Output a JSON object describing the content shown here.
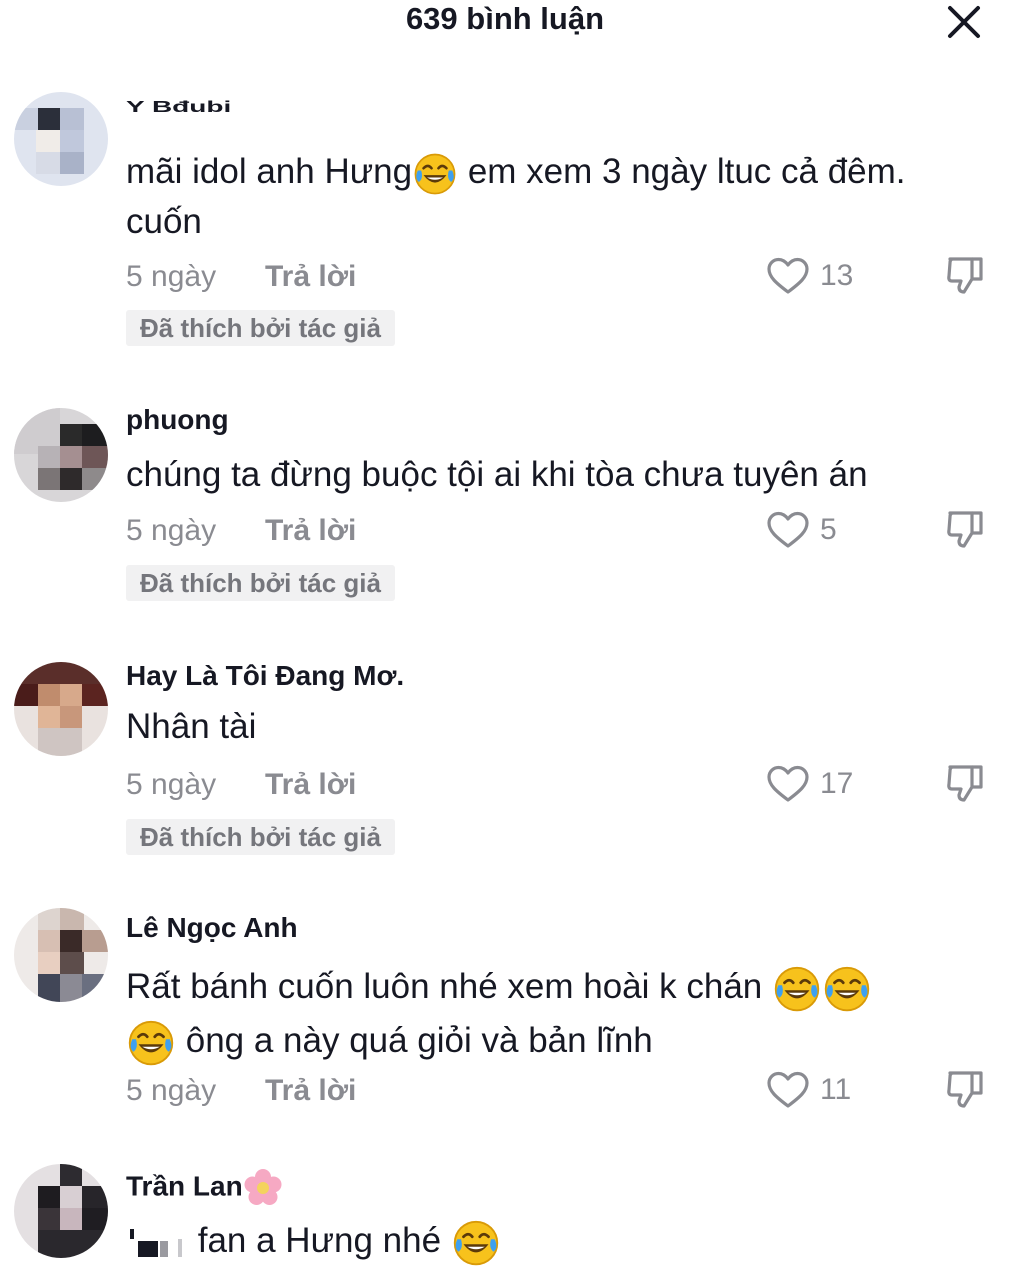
{
  "header": {
    "title": "639 bình luận",
    "close_icon": "close-icon"
  },
  "comments": [
    {
      "username": "Y Bđubi",
      "text_parts": [
        "mãi idol anh Hưng",
        " em xem 3 ngày ltuc cả đêm. cuốn"
      ],
      "time": "5 ngày",
      "reply": "Trả lời",
      "likes": "13",
      "badge": "Đã thích bởi tác giả"
    },
    {
      "username": "phuong",
      "text_parts": [
        "chúng ta đừng buộc tội ai khi tòa chưa tuyên án"
      ],
      "time": "5 ngày",
      "reply": "Trả lời",
      "likes": "5",
      "badge": "Đã thích bởi tác giả"
    },
    {
      "username": "Hay Là Tôi Đang Mơ.",
      "text_parts": [
        "Nhân tài"
      ],
      "time": "5 ngày",
      "reply": "Trả lời",
      "likes": "17",
      "badge": "Đã thích bởi tác giả"
    },
    {
      "username": "Lê Ngọc Anh",
      "text_parts": [
        "Rất bánh cuốn luôn nhé xem hoài k chán ",
        " ông a này quá giỏi và bản lĩnh"
      ],
      "time": "5 ngày",
      "reply": "Trả lời",
      "likes": "11"
    },
    {
      "username": "Trần Lan",
      "text_parts": [
        " fan a Hưng nhé "
      ]
    }
  ],
  "colors": {
    "text": "#161823",
    "muted": "#8a8b91",
    "badge_bg": "#f1f1f2",
    "badge_text": "#75767c"
  },
  "icons": [
    "close-icon",
    "heart-icon",
    "dislike-icon",
    "laughing-emoji",
    "flower-emoji"
  ]
}
